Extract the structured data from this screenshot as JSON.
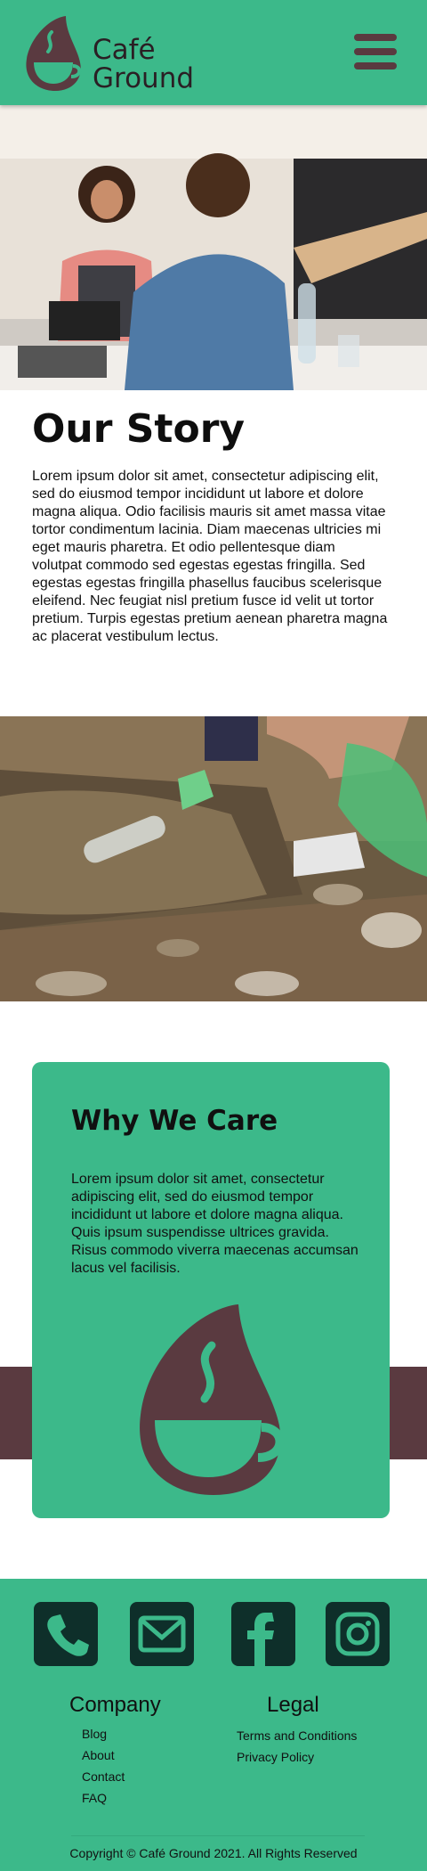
{
  "header": {
    "brand_line1": "Café",
    "brand_line2": "Ground",
    "logo_icon": "coffee-drop-logo-icon",
    "menu_icon": "hamburger-menu-icon"
  },
  "images": {
    "hero": "barista-serving-customer-photo",
    "cleanup": "river-cleanup-photo"
  },
  "story": {
    "title": "Our Story",
    "body": "Lorem ipsum dolor sit amet, consectetur adipiscing elit, sed do eiusmod tempor incididunt ut labore et dolore magna aliqua. Odio facilisis mauris sit amet massa vitae tortor condimentum lacinia. Diam maecenas ultricies mi eget mauris pharetra. Et odio pellentesque diam volutpat commodo sed egestas egestas fringilla. Sed egestas egestas fringilla phasellus faucibus scelerisque eleifend. Nec feugiat nisl pretium fusce id velit ut tortor pretium. Turpis egestas pretium aenean pharetra magna ac placerat vestibulum lectus."
  },
  "care": {
    "title": "Why We Care",
    "body": "Lorem ipsum dolor sit amet, consectetur adipiscing elit, sed do eiusmod tempor incididunt ut labore et dolore magna aliqua. Quis ipsum suspendisse ultrices gravida. Risus commodo viverra maecenas accumsan lacus vel facilisis.",
    "icon": "coffee-cup-drop-icon"
  },
  "footer": {
    "social": [
      "phone-icon",
      "mail-icon",
      "facebook-icon",
      "instagram-icon"
    ],
    "company_title": "Company",
    "company_links": [
      "Blog",
      "About",
      "Contact",
      "FAQ"
    ],
    "legal_title": "Legal",
    "legal_links": [
      "Terms and Conditions",
      "Privacy Policy"
    ],
    "copyright": "Copyright © Café Ground 2021. All Rights Reserved"
  },
  "colors": {
    "primary_green": "#3cb98a",
    "accent_maroon": "#5a3a40",
    "icon_dark": "#0e2f2a"
  }
}
